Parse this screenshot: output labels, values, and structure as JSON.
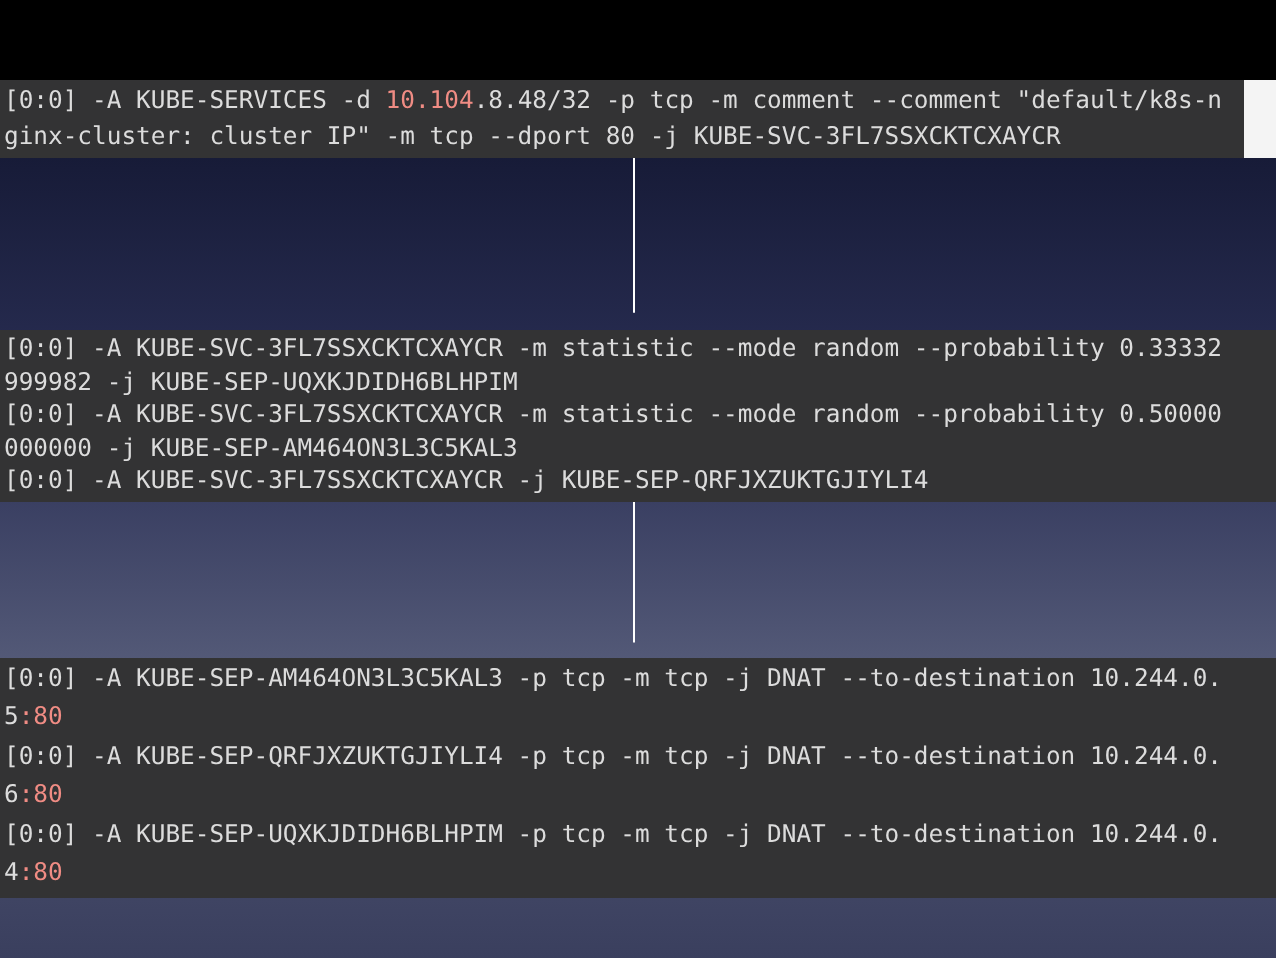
{
  "panels": [
    {
      "cursor": true,
      "lines": [
        [
          {
            "text": "[0:0] -A KUBE-SERVICES -d ",
            "highlight": false
          },
          {
            "text": "10.104",
            "highlight": true
          },
          {
            "text": ".8.48/32 -p tcp -m comment --comment \"default/k8s-n",
            "highlight": false
          }
        ],
        [
          {
            "text": "ginx-cluster: cluster IP\" -m tcp --dport 80 -j KUBE-SVC-3FL7SSXCKTCXAYCR",
            "highlight": false
          }
        ]
      ]
    },
    {
      "cursor": false,
      "lines": [
        [
          {
            "text": "[0:0] -A KUBE-SVC-3FL7SSXCKTCXAYCR -m statistic --mode random --probability 0.33332",
            "highlight": false
          }
        ],
        [
          {
            "text": "999982 -j KUBE-SEP-UQXKJDIDH6BLHPIM",
            "highlight": false
          }
        ],
        [
          {
            "text": "[0:0] -A KUBE-SVC-3FL7SSXCKTCXAYCR -m statistic --mode random --probability 0.50000",
            "highlight": false
          }
        ],
        [
          {
            "text": "000000 -j KUBE-SEP-AM464ON3L3C5KAL3",
            "highlight": false
          }
        ],
        [
          {
            "text": "[0:0] -A KUBE-SVC-3FL7SSXCKTCXAYCR -j KUBE-SEP-QRFJXZUKTGJIYLI4",
            "highlight": false
          }
        ]
      ]
    },
    {
      "cursor": false,
      "lines": [
        [
          {
            "text": "[0:0] -A KUBE-SEP-AM464ON3L3C5KAL3 -p tcp -m tcp -j DNAT --to-destination 10.244.0.",
            "highlight": false
          }
        ],
        [
          {
            "text": "5",
            "highlight": false
          },
          {
            "text": ":80",
            "highlight": true
          }
        ],
        [
          {
            "text": "[0:0] -A KUBE-SEP-QRFJXZUKTGJIYLI4 -p tcp -m tcp -j DNAT --to-destination 10.244.0.",
            "highlight": false
          }
        ],
        [
          {
            "text": "6",
            "highlight": false
          },
          {
            "text": ":80",
            "highlight": true
          }
        ],
        [
          {
            "text": "[0:0] -A KUBE-SEP-UQXKJDIDH6BLHPIM -p tcp -m tcp -j DNAT --to-destination 10.244.0.",
            "highlight": false
          }
        ],
        [
          {
            "text": "4",
            "highlight": false
          },
          {
            "text": ":80",
            "highlight": true
          }
        ]
      ]
    }
  ]
}
